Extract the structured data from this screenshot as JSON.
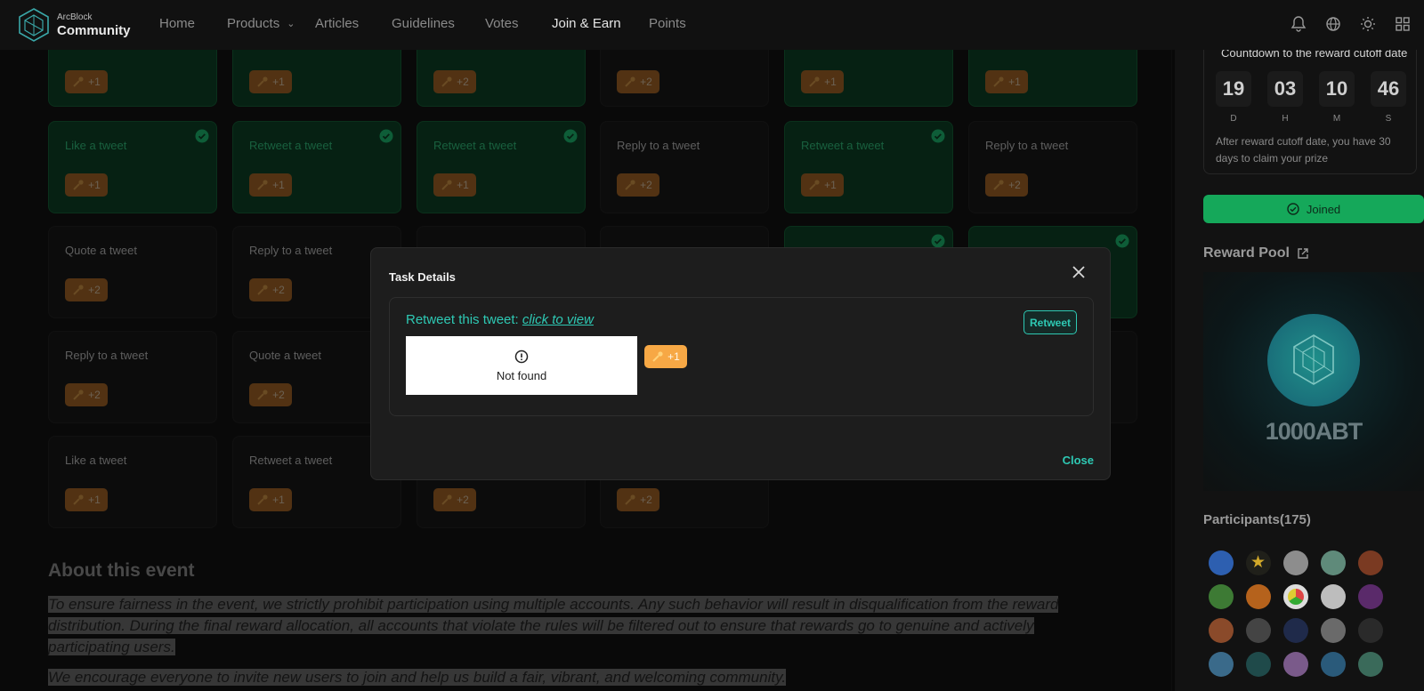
{
  "brand": {
    "small": "ArcBlock",
    "big": "Community"
  },
  "nav": [
    {
      "label": "Home",
      "active": false
    },
    {
      "label": "Products",
      "active": false,
      "dropdown": true
    },
    {
      "label": "Articles",
      "active": false
    },
    {
      "label": "Guidelines",
      "active": false
    },
    {
      "label": "Votes",
      "active": false
    },
    {
      "label": "Join & Earn",
      "active": true
    },
    {
      "label": "Points",
      "active": false
    }
  ],
  "header_icons": [
    "bell-icon",
    "globe-icon",
    "sun-icon",
    "apps-icon"
  ],
  "tasks": {
    "row0": [
      "+1",
      "+1",
      "+2",
      "+2",
      "+1",
      "+1"
    ],
    "row1": [
      {
        "label": "Like a tweet",
        "points": "+1",
        "done": true
      },
      {
        "label": "Retweet a tweet",
        "points": "+1",
        "done": true
      },
      {
        "label": "Retweet a tweet",
        "points": "+1",
        "done": true
      },
      {
        "label": "Reply to a tweet",
        "points": "+2",
        "done": false
      },
      {
        "label": "Retweet a tweet",
        "points": "+1",
        "done": true
      },
      {
        "label": "Reply to a tweet",
        "points": "+2",
        "done": false
      }
    ],
    "row2": [
      {
        "label": "Quote a tweet",
        "points": "+2",
        "done": false
      },
      {
        "label": "Reply to a tweet",
        "points": "+2",
        "done": false
      }
    ],
    "row3": [
      {
        "label": "Reply to a tweet",
        "points": "+2",
        "done": false
      },
      {
        "label": "Quote a tweet",
        "points": "+2",
        "done": false
      }
    ],
    "row4": [
      {
        "label": "Like a tweet",
        "points": "+1",
        "done": false
      },
      {
        "label": "Retweet a tweet",
        "points": "+1",
        "done": false
      },
      {
        "label": "",
        "points": "+2",
        "done": false
      },
      {
        "label": "",
        "points": "+2",
        "done": false
      }
    ]
  },
  "about": {
    "title": "About this event",
    "para1_line1": "To ensure fairness in the event, we strictly prohibit participation using multiple accounts. Any such behavior will result in disqualification from the reward",
    "para1_line2": "distribution. During the final reward allocation, all accounts that violate the rules will be filtered out to ensure that rewards go to genuine and actively",
    "para1_line3": "participating users.",
    "para2": "We encourage everyone to invite new users to join and help us build a fair, vibrant, and welcoming community."
  },
  "countdown": {
    "title": "Countdown to the reward cutoff date",
    "days": "19",
    "hours": "03",
    "minutes": "10",
    "seconds": "46",
    "day_label": "D",
    "hour_label": "H",
    "minute_label": "M",
    "second_label": "S",
    "note": "After reward cutoff date, you have 30 days to claim your prize"
  },
  "joined_label": "Joined",
  "reward_pool": {
    "title": "Reward Pool",
    "amount": "1000ABT"
  },
  "participants": {
    "title": "Participants(175)"
  },
  "modal": {
    "title": "Task Details",
    "task_prefix": "Retweet this tweet: ",
    "task_link": "click to view",
    "retweet_label": "Retweet",
    "not_found": "Not found",
    "points": "+1",
    "close_label": "Close"
  },
  "colors": {
    "accent": "#2ec9b4",
    "done_green": "#0f4a2a",
    "badge": "#b5702c",
    "joined": "#15a85a"
  }
}
